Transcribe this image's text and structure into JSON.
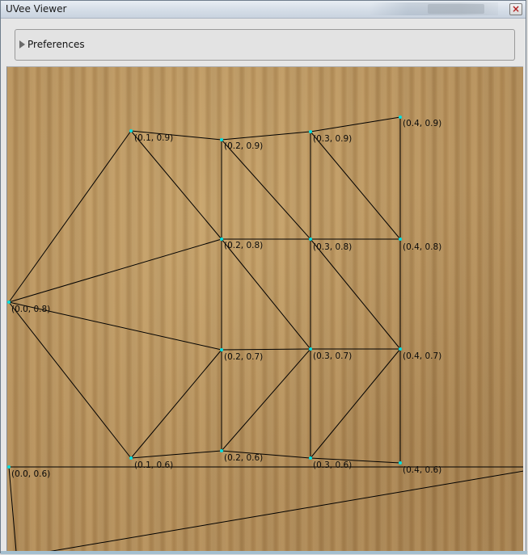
{
  "window": {
    "title": "UVee Viewer",
    "close_label": "×"
  },
  "preferences": {
    "label": "Preferences"
  },
  "colors": {
    "vertex": "#00e0e0",
    "edge": "#000000"
  },
  "uv_labels": [
    "(0.1, 0.9)",
    "(0.2, 0.9)",
    "(0.3, 0.9)",
    "(0.4, 0.9)",
    "(0.2, 0.8)",
    "(0.3, 0.8)",
    "(0.4, 0.8)",
    "(0.0, 0.8)",
    "(0.2, 0.7)",
    "(0.3, 0.7)",
    "(0.4, 0.7)",
    "(0.1, 0.6)",
    "(0.2, 0.6)",
    "(0.3, 0.6)",
    "(0.4, 0.6)",
    "(0.0, 0.6)"
  ]
}
